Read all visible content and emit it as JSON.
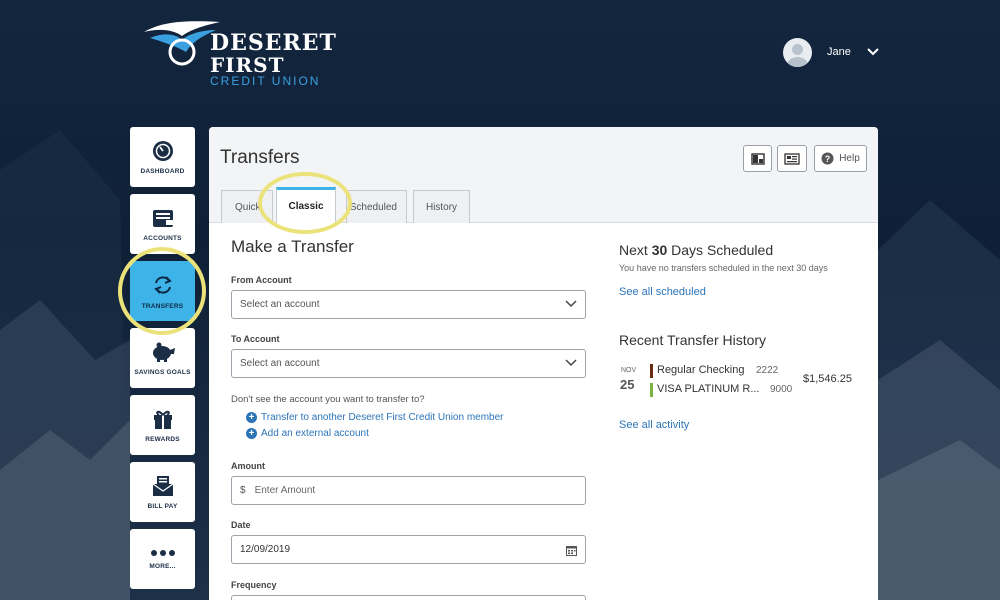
{
  "brand": {
    "line1": "DESERET",
    "line2": "FIRST",
    "line3": "CREDIT UNION"
  },
  "user": {
    "name": "Jane"
  },
  "nav": [
    {
      "label": "DASHBOARD",
      "icon": "gauge-icon"
    },
    {
      "label": "ACCOUNTS",
      "icon": "wallet-icon"
    },
    {
      "label": "TRANSFERS",
      "icon": "transfer-arrows-icon",
      "active": true
    },
    {
      "label": "SAVINGS GOALS",
      "icon": "piggy-bank-icon"
    },
    {
      "label": "REWARDS",
      "icon": "gift-icon"
    },
    {
      "label": "BILL PAY",
      "icon": "envelope-bill-icon"
    },
    {
      "label": "MORE...",
      "icon": "more-dots-icon"
    }
  ],
  "page": {
    "title": "Transfers",
    "help_label": "Help",
    "tabs": [
      {
        "label": "Quick"
      },
      {
        "label": "Classic",
        "active": true
      },
      {
        "label": "Scheduled"
      },
      {
        "label": "History"
      }
    ]
  },
  "form": {
    "title": "Make a Transfer",
    "from_label": "From Account",
    "from_placeholder": "Select an account",
    "to_label": "To Account",
    "to_placeholder": "Select an account",
    "missing_question": "Don't see the account you want to transfer to?",
    "link_member": "Transfer to another Deseret First Credit Union member",
    "link_external": "Add an external account",
    "amount_label": "Amount",
    "amount_prefix": "$",
    "amount_placeholder": "Enter Amount",
    "date_label": "Date",
    "date_value": "12/09/2019",
    "frequency_label": "Frequency"
  },
  "scheduled": {
    "title_pre": "Next ",
    "title_bold": "30",
    "title_post": " Days Scheduled",
    "empty_text": "You have no transfers scheduled in the next 30 days",
    "link": "See all scheduled"
  },
  "history": {
    "title": "Recent Transfer History",
    "items": [
      {
        "month": "NOV",
        "day": "25",
        "from_name": "Regular Checking",
        "from_num": "2222",
        "to_name": "VISA PLATINUM R...",
        "to_num": "9000",
        "amount": "$1,546.25"
      }
    ],
    "link": "See all activity"
  },
  "colors": {
    "accent": "#3db3e8",
    "highlight_ring": "#ece27a",
    "link": "#2c74b8",
    "from_bar": "#6b2a12",
    "to_bar": "#7cb342"
  }
}
